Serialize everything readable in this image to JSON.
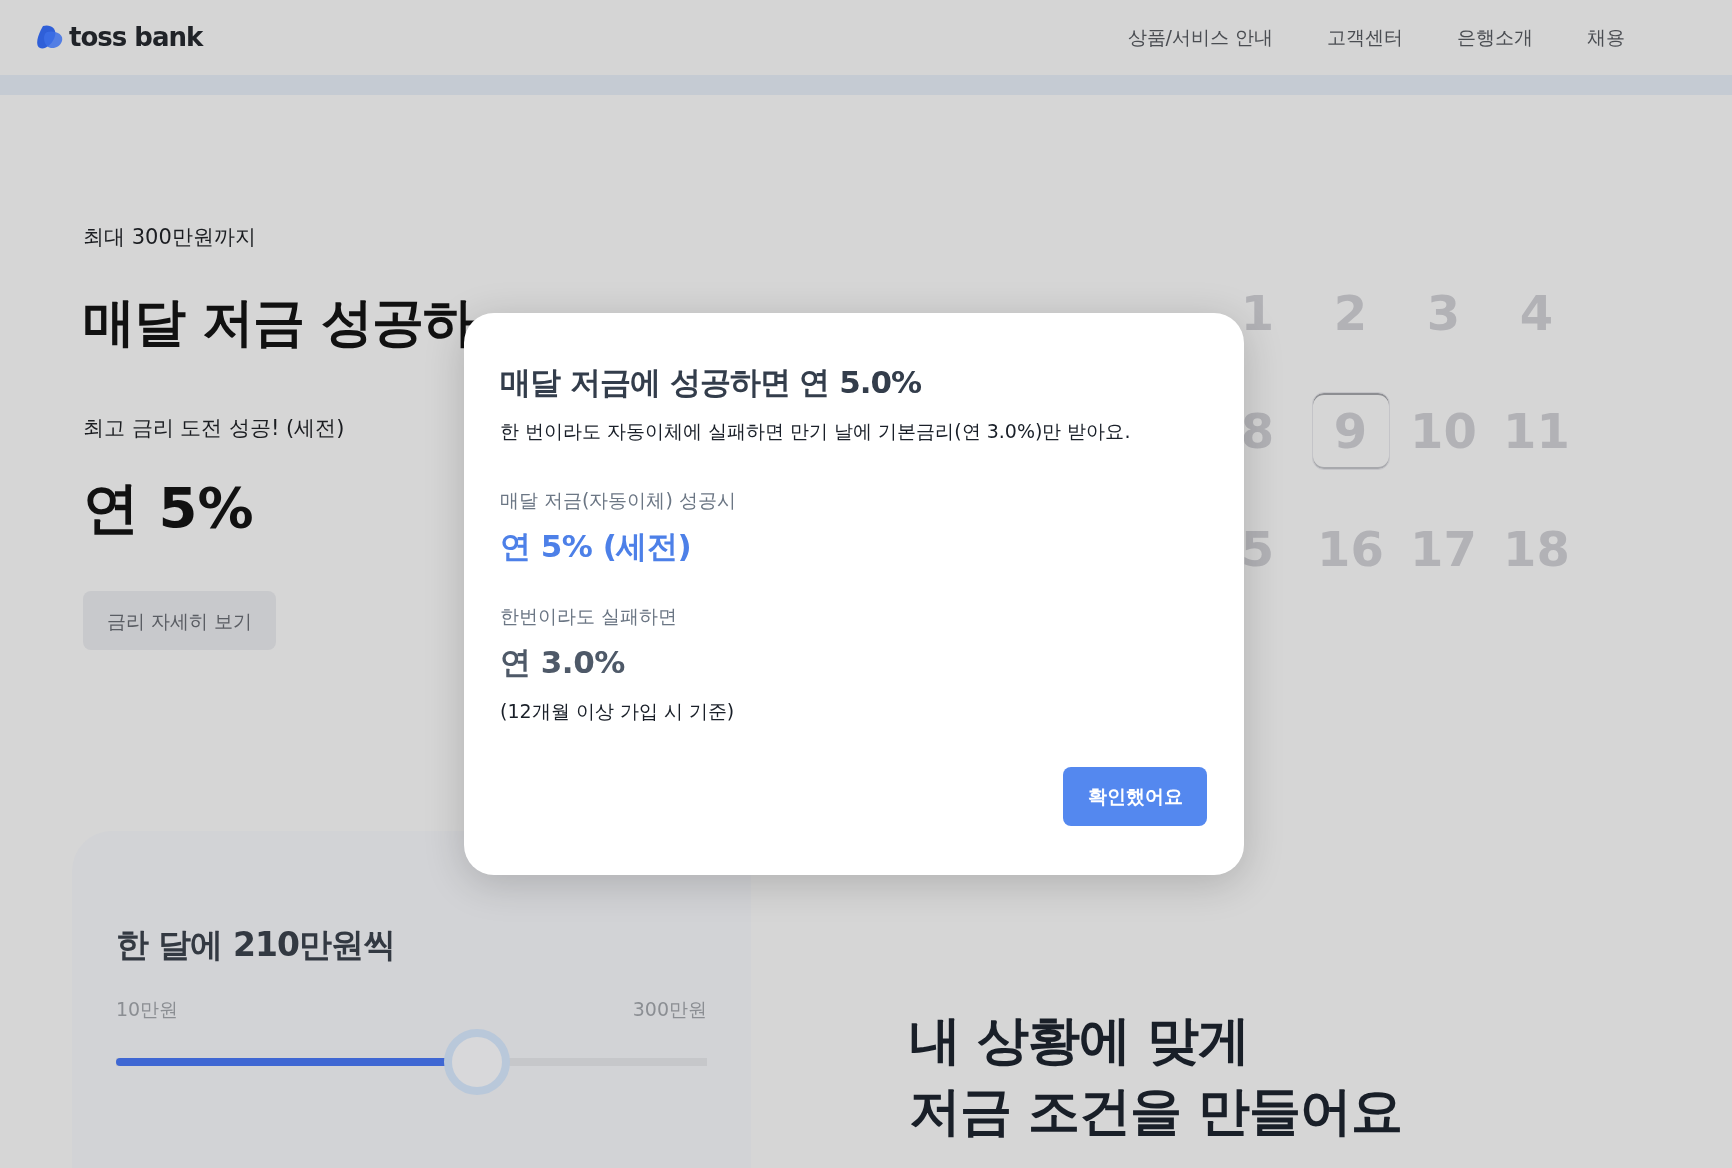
{
  "header": {
    "logo": "toss bank",
    "nav": [
      "상품/서비스 안내",
      "고객센터",
      "은행소개",
      "채용"
    ]
  },
  "hero": {
    "eyebrow": "최대 300만원까지",
    "headline": "매달 저금 성공하",
    "subtitle": "최고 금리 도전 성공! (세전)",
    "rate": "연 5%",
    "button": "금리 자세히 보기"
  },
  "calendar": {
    "rows": [
      {
        "days": [
          {
            "label": "1",
            "selected": false
          },
          {
            "label": "2",
            "selected": false
          },
          {
            "label": "3",
            "selected": false
          },
          {
            "label": "4",
            "selected": false
          }
        ]
      },
      {
        "days": [
          {
            "label": "8",
            "selected": false
          },
          {
            "label": "9",
            "selected": true
          },
          {
            "label": "10",
            "selected": false
          },
          {
            "label": "11",
            "selected": false
          }
        ]
      },
      {
        "days": [
          {
            "label": "5",
            "selected": false
          },
          {
            "label": "16",
            "selected": false
          },
          {
            "label": "17",
            "selected": false
          },
          {
            "label": "18",
            "selected": false
          }
        ]
      }
    ]
  },
  "amount_card": {
    "title": "한 달에 210만원씩",
    "min_label": "10만원",
    "max_label": "300만원",
    "slider": {
      "level": 0.61
    }
  },
  "feature_heading": [
    "내 상황에 맞게",
    "저금 조건을 만들어요"
  ],
  "dialog": {
    "title": "매달 저금에 성공하면 연 5.0%",
    "description": "한 번이라도 자동이체에 실패하면 만기 날에 기본금리(연 3.0%)만 받아요.",
    "sections": [
      {
        "label": "매달 저금(자동이체) 성공시",
        "value": "연 5% (세전)",
        "kind": "highlight"
      },
      {
        "label": "한번이라도 실패하면",
        "value": "연 3.0%",
        "kind": "plain"
      }
    ],
    "note": "(12개월 이상 가입 시 기준)",
    "confirm_button": "확인했어요"
  }
}
